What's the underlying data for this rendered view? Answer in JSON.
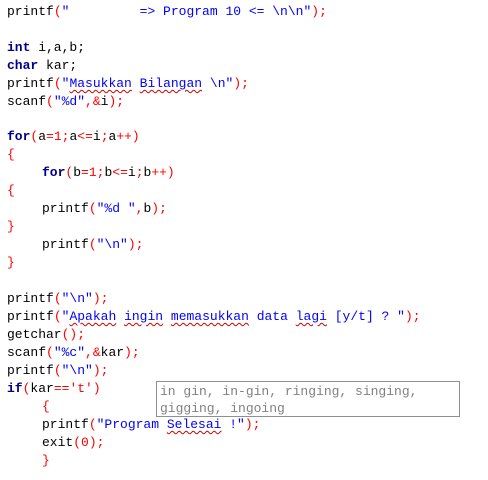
{
  "code": {
    "l1": {
      "fn": "printf",
      "p1": "(",
      "str": "\"         => Program 10 <= \\n\\n\"",
      "p2": ");"
    },
    "l2": {
      "kw": "int",
      "rest": " i,a,b;"
    },
    "l3": {
      "kw": "char",
      "rest": " kar;"
    },
    "l4": {
      "fn": "printf",
      "p1": "(",
      "s1": "\"",
      "w1": "Masukkan",
      "s2": " ",
      "w2": "Bilangan",
      "s3": " \\n\"",
      "p2": ");"
    },
    "l5": {
      "fn": "scanf",
      "p1": "(",
      "str": "\"%d\"",
      "p2": ",&",
      "var": "i",
      "p3": ");"
    },
    "l6": {
      "kw": "for",
      "p1": "(",
      "v1": "a",
      "op1": "=",
      "n1": "1",
      "op2": ";",
      "v2": "a",
      "op3": "<=",
      "v3": "i",
      "op4": ";",
      "v4": "a",
      "op5": "++)"
    },
    "l7": {
      "p": "{"
    },
    "l8": {
      "kw": "for",
      "p1": "(",
      "v1": "b",
      "op1": "=",
      "n1": "1",
      "op2": ";",
      "v2": "b",
      "op3": "<=",
      "v3": "i",
      "op4": ";",
      "v4": "b",
      "op5": "++)"
    },
    "l9": {
      "p": "{"
    },
    "l10": {
      "fn": "printf",
      "p1": "(",
      "str": "\"%d \"",
      "p2": ",",
      "var": "b",
      "p3": ");"
    },
    "l11": {
      "p": "}"
    },
    "l12": {
      "fn": "printf",
      "p1": "(",
      "str": "\"\\n\"",
      "p2": ");"
    },
    "l13": {
      "p": "}"
    },
    "l14": {
      "fn": "printf",
      "p1": "(",
      "str": "\"\\n\"",
      "p2": ");"
    },
    "l15": {
      "fn": "printf",
      "p1": "(",
      "s1": "\"",
      "w1": "Apakah",
      "s2": " ",
      "w2": "ingin",
      "s3": " ",
      "w3": "memasukkan",
      "s4": " data ",
      "w4": "lagi",
      "s5": " [y/t] ? \"",
      "p2": ");"
    },
    "l16": {
      "fn": "getchar",
      "p1": "();"
    },
    "l17": {
      "fn": "scanf",
      "p1": "(",
      "str": "\"%c\"",
      "p2": ",&",
      "var": "kar",
      "p3": ");"
    },
    "l18": {
      "fn": "printf",
      "p1": "(",
      "str": "\"\\n\"",
      "p2": ");"
    },
    "l19": {
      "kw": "if",
      "p1": "(",
      "var": "kar",
      "op": "==",
      "str": "'t'",
      "p2": ")"
    },
    "l20": {
      "p": "{"
    },
    "l21": {
      "fn": "printf",
      "p1": "(",
      "s1": "\"Program ",
      "w1": "Selesai",
      "s2": " !\"",
      "p2": ");"
    },
    "l22": {
      "fn": "exit",
      "p1": "(",
      "num": "0",
      "p2": ");"
    },
    "l23": {
      "p": "}"
    }
  },
  "suggestions": {
    "line1": "in gin, in-gin, ringing, singing,",
    "line2": "gigging, ingoing"
  },
  "colors": {
    "keyword": "#00008b",
    "punctuation": "#ff0000",
    "string": "#0000ff",
    "number": "#ff0000",
    "spell_underline": "#cc0000",
    "suggestion_text": "#808080"
  }
}
